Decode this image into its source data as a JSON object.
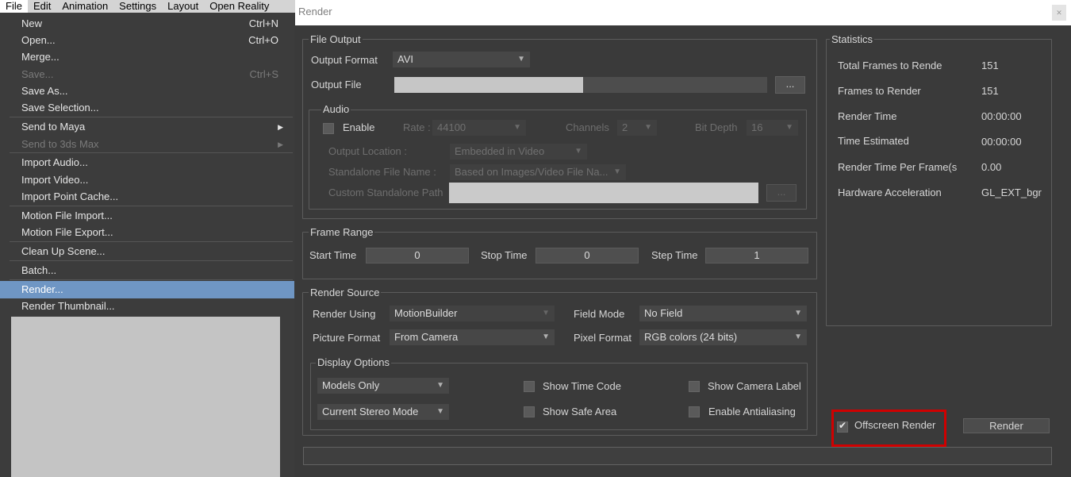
{
  "menubar": {
    "items": [
      "File",
      "Edit",
      "Animation",
      "Settings",
      "Layout",
      "Open Reality"
    ]
  },
  "file_menu": {
    "new": {
      "label": "New",
      "shortcut": "Ctrl+N"
    },
    "open": {
      "label": "Open...",
      "shortcut": "Ctrl+O"
    },
    "merge": {
      "label": "Merge..."
    },
    "save": {
      "label": "Save...",
      "shortcut": "Ctrl+S"
    },
    "save_as": {
      "label": "Save As..."
    },
    "save_selection": {
      "label": "Save Selection..."
    },
    "send_maya": {
      "label": "Send to Maya"
    },
    "send_3ds": {
      "label": "Send to 3ds Max"
    },
    "import_audio": {
      "label": "Import Audio..."
    },
    "import_video": {
      "label": "Import Video..."
    },
    "import_point_cache": {
      "label": "Import Point Cache..."
    },
    "motion_import": {
      "label": "Motion File Import..."
    },
    "motion_export": {
      "label": "Motion File Export..."
    },
    "clean_up": {
      "label": "Clean Up Scene..."
    },
    "batch": {
      "label": "Batch..."
    },
    "render": {
      "label": "Render..."
    },
    "render_thumbnail": {
      "label": "Render Thumbnail..."
    }
  },
  "render_window": {
    "title": "Render",
    "close_icon": "close-icon",
    "file_output": {
      "group_label": "File Output",
      "output_format_label": "Output Format",
      "output_format_value": "AVI",
      "output_file_label": "Output File",
      "browse_label": "...",
      "audio": {
        "group_label": "Audio",
        "enable_label": "Enable",
        "rate_label": "Rate :",
        "rate_value": "44100",
        "channels_label": "Channels",
        "channels_value": "2",
        "bit_depth_label": "Bit Depth",
        "bit_depth_value": "16",
        "output_location_label": "Output Location :",
        "output_location_value": "Embedded in Video",
        "standalone_name_label": "Standalone File Name :",
        "standalone_name_value": "Based on Images/Video File Na...",
        "custom_path_label": "Custom Standalone Path",
        "custom_browse_label": "..."
      }
    },
    "frame_range": {
      "group_label": "Frame Range",
      "start_label": "Start Time",
      "start_value": "0",
      "stop_label": "Stop Time",
      "stop_value": "0",
      "step_label": "Step Time",
      "step_value": "1"
    },
    "render_source": {
      "group_label": "Render Source",
      "render_using_label": "Render Using",
      "render_using_value": "MotionBuilder",
      "field_mode_label": "Field Mode",
      "field_mode_value": "No Field",
      "picture_format_label": "Picture Format",
      "picture_format_value": "From Camera",
      "pixel_format_label": "Pixel Format",
      "pixel_format_value": "RGB colors (24 bits)",
      "display_options": {
        "group_label": "Display Options",
        "models_value": "Models Only",
        "stereo_value": "Current Stereo Mode",
        "show_time_code": "Show Time Code",
        "show_safe_area": "Show Safe Area",
        "show_camera_label": "Show Camera Label",
        "enable_antialiasing": "Enable Antialiasing"
      }
    },
    "statistics": {
      "group_label": "Statistics",
      "rows": [
        {
          "label": "Total Frames to Rende",
          "value": "151"
        },
        {
          "label": "Frames to Render",
          "value": "151"
        },
        {
          "label": "Render Time",
          "value": "00:00:00"
        },
        {
          "label": "Time Estimated",
          "value": "00:00:00"
        },
        {
          "label": "Render Time Per Frame(s",
          "value": "0.00"
        },
        {
          "label": "Hardware Acceleration",
          "value": "GL_EXT_bgr"
        }
      ]
    },
    "offscreen_render_label": "Offscreen Render",
    "offscreen_checked": true,
    "render_button_label": "Render",
    "highlight_color": "#d00000"
  }
}
